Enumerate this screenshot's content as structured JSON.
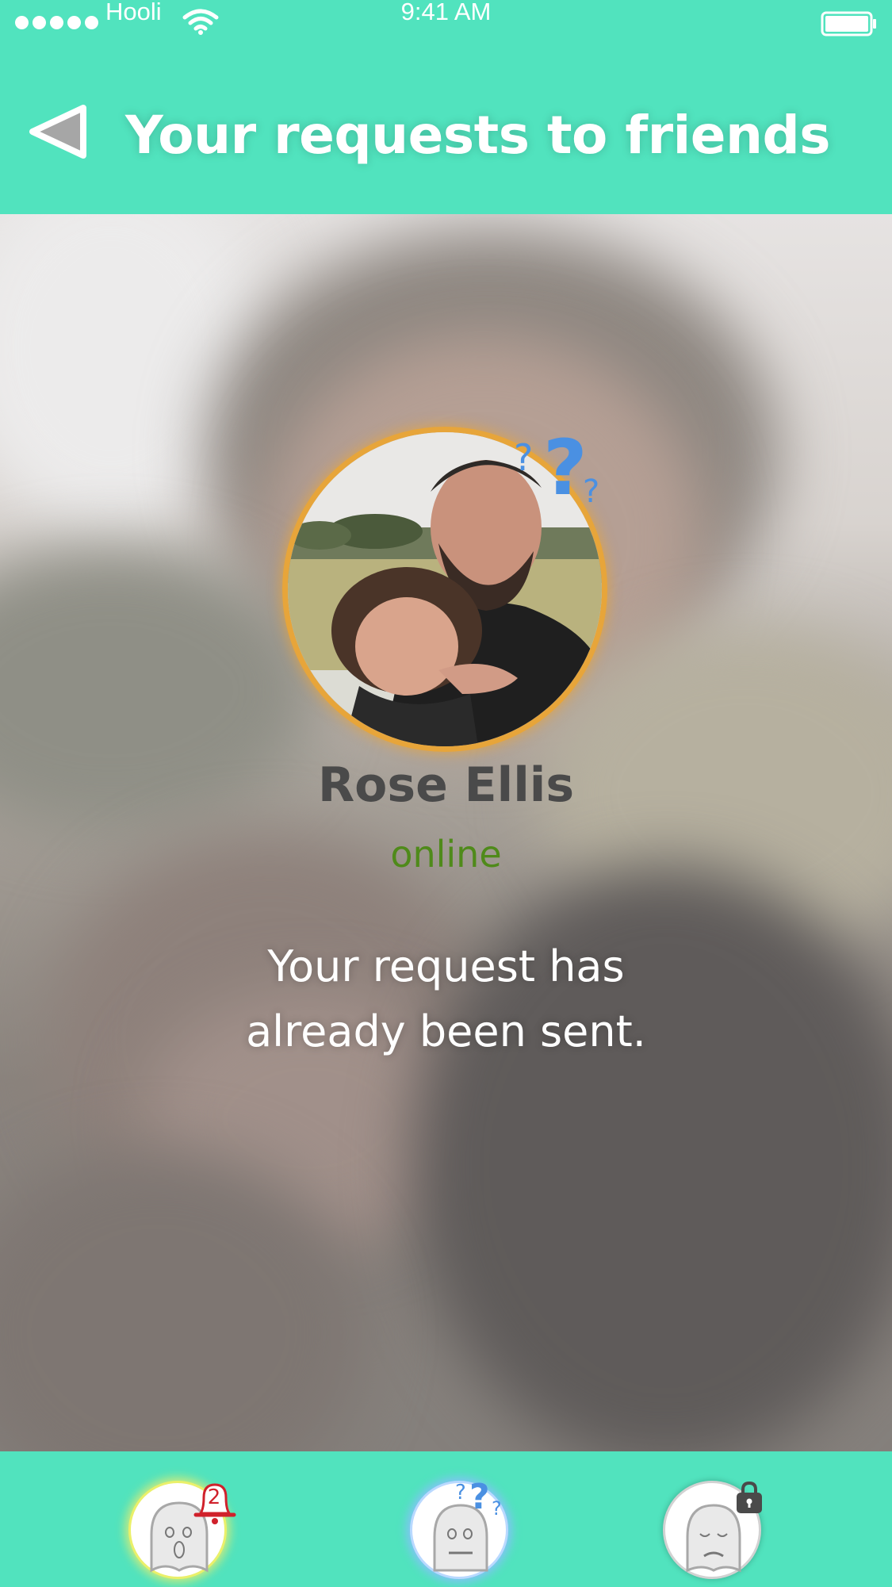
{
  "status_bar": {
    "carrier": "Hooli",
    "time": "9:41 AM"
  },
  "header": {
    "title": "Your requests to friends",
    "back_icon": "back-triangle-icon"
  },
  "profile": {
    "name": "Rose Ellis",
    "status": "online",
    "status_color": "#4f8a1a",
    "avatar_ring_color": "#e7a53a",
    "badge_icon": "question-marks-icon"
  },
  "message": {
    "line1": "Your request has",
    "line2": "already been sent."
  },
  "tab_bar": {
    "notifications": {
      "icon": "ghost-surprised-icon",
      "badge_icon": "bell-icon",
      "badge_count": "2"
    },
    "requests": {
      "icon": "ghost-flat-icon",
      "badge_icon": "question-marks-icon"
    },
    "private": {
      "icon": "ghost-sleepy-icon",
      "badge_icon": "lock-icon"
    }
  },
  "colors": {
    "accent": "#51e3be",
    "title_text": "#ffffff",
    "name_text": "#4a4a4a",
    "badge_red": "#d0212b",
    "question_blue": "#4a90e2"
  }
}
